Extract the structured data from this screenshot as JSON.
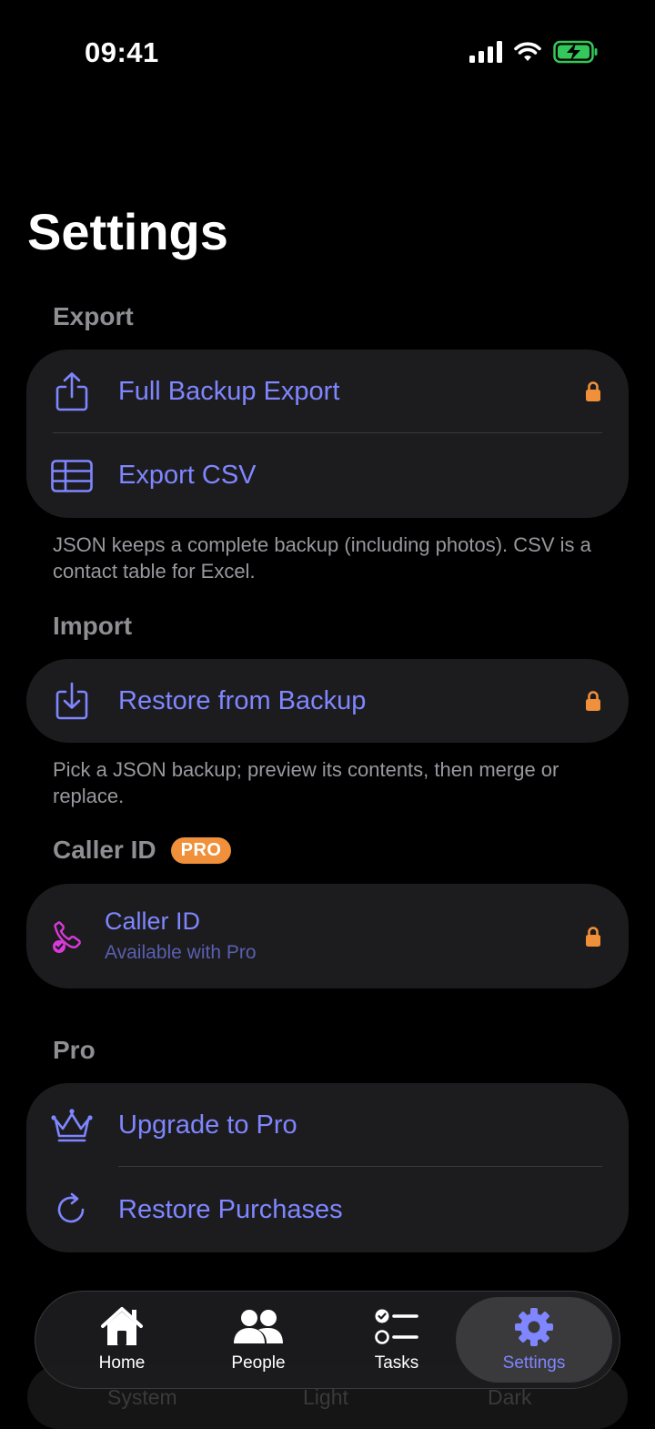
{
  "status_bar": {
    "time": "09:41"
  },
  "page_title": "Settings",
  "export": {
    "header": "Export",
    "full_backup_label": "Full Backup Export",
    "csv_label": "Export CSV",
    "footnote": "JSON keeps a complete backup (including photos). CSV is a contact table for Excel."
  },
  "import": {
    "header": "Import",
    "restore_label": "Restore from Backup",
    "footnote": "Pick a JSON backup; preview its contents, then merge or replace."
  },
  "caller_id": {
    "header": "Caller ID",
    "badge": "PRO",
    "title": "Caller ID",
    "subtitle": "Available with Pro"
  },
  "pro": {
    "header": "Pro",
    "upgrade_label": "Upgrade to Pro",
    "restore_purchases_label": "Restore Purchases"
  },
  "appearance_behind": {
    "options": [
      "System",
      "Light",
      "Dark"
    ]
  },
  "tab_bar": {
    "items": [
      {
        "label": "Home",
        "icon": "house-icon"
      },
      {
        "label": "People",
        "icon": "people-icon"
      },
      {
        "label": "Tasks",
        "icon": "checklist-icon"
      },
      {
        "label": "Settings",
        "icon": "gear-icon"
      }
    ],
    "active": "Settings"
  },
  "colors": {
    "accent": "#7f86ff",
    "lock": "#f0903a",
    "card": "#1c1c1e",
    "caller_icon": "#d83ad8"
  }
}
